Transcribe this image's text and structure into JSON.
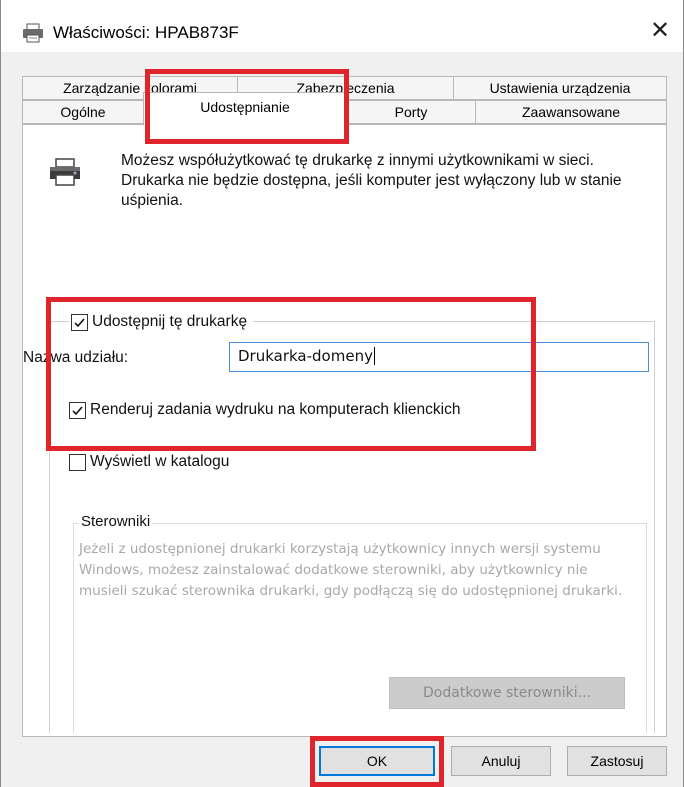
{
  "window": {
    "title": "Właściwości: HPAB873F",
    "close": "✕"
  },
  "tabs_row1": [
    {
      "label": "Zarządzanie kolorami"
    },
    {
      "label": "Zabezpieczenia"
    },
    {
      "label": "Ustawienia urządzenia"
    }
  ],
  "tabs_row2": [
    {
      "label": "Ogólne"
    },
    {
      "label": "Udostępnianie",
      "active": true
    },
    {
      "label": "Porty"
    },
    {
      "label": "Zaawansowane"
    }
  ],
  "intro": {
    "icon": "printer-icon",
    "text": "Możesz współużytkować tę drukarkę z innymi użytkownikami w sieci. Drukarka nie będzie dostępna, jeśli komputer jest wyłączony lub w stanie uśpienia."
  },
  "sharing": {
    "share_checkbox_label": "Udostępnij tę drukarkę",
    "share_checked": true,
    "share_name_label": "Nazwa udziału:",
    "share_name_value": "Drukarka-domeny",
    "render_label": "Renderuj zadania wydruku na komputerach klienckich",
    "render_checked": true,
    "list_label": "Wyświetl w katalogu",
    "list_checked": false
  },
  "drivers": {
    "legend": "Sterowniki",
    "text": "Jeżeli z udostępnionej drukarki korzystają użytkownicy innych wersji systemu Windows, możesz zainstalować dodatkowe sterowniki, aby użytkownicy nie musieli szukać sterownika drukarki, gdy podłączą się do udostępnionej drukarki.",
    "button": "Dodatkowe sterowniki..."
  },
  "buttons": {
    "ok": "OK",
    "cancel": "Anuluj",
    "apply": "Zastosuj"
  },
  "colors": {
    "highlight": "#e0242c",
    "focus": "#0078d7"
  }
}
